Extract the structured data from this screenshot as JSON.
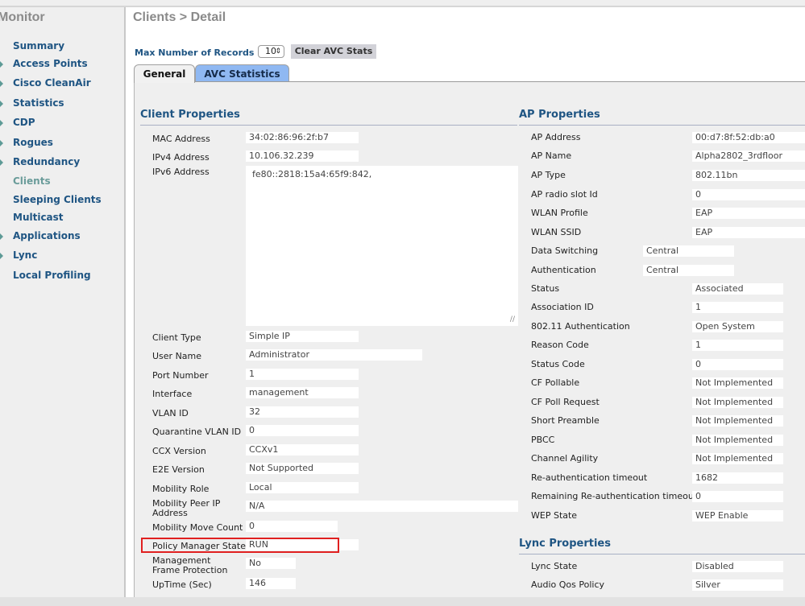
{
  "sidebar": {
    "title": "Monitor",
    "items": [
      {
        "label": "Summary",
        "expandable": false,
        "active": false
      },
      {
        "label": "Access Points",
        "expandable": true,
        "active": false
      },
      {
        "label": "Cisco CleanAir",
        "expandable": true,
        "active": false
      },
      {
        "label": "Statistics",
        "expandable": true,
        "active": false
      },
      {
        "label": "CDP",
        "expandable": true,
        "active": false
      },
      {
        "label": "Rogues",
        "expandable": true,
        "active": false
      },
      {
        "label": "Redundancy",
        "expandable": true,
        "active": false
      },
      {
        "label": "Clients",
        "expandable": false,
        "active": true
      },
      {
        "label": "Sleeping Clients",
        "expandable": false,
        "active": false
      },
      {
        "label": "Multicast",
        "expandable": false,
        "active": false
      },
      {
        "label": "Applications",
        "expandable": true,
        "active": false
      },
      {
        "label": "Lync",
        "expandable": true,
        "active": false
      },
      {
        "label": "Local Profiling",
        "expandable": false,
        "active": false
      }
    ]
  },
  "header": {
    "title": "Clients > Detail",
    "max_records_label": "Max Number of Records",
    "max_records_value": "10",
    "clear_avc_label": "Clear AVC Stats"
  },
  "tabs": [
    {
      "label": "General",
      "active": true
    },
    {
      "label": "AVC Statistics",
      "active": false
    }
  ],
  "client_properties": {
    "title": "Client Properties",
    "fields": [
      {
        "label": "MAC Address",
        "value": "34:02:86:96:2f:b7"
      },
      {
        "label": "IPv4 Address",
        "value": "10.106.32.239"
      },
      {
        "label": "IPv6 Address",
        "value": "fe80::2818:15a4:65f9:842,"
      },
      {
        "label": "Client Type",
        "value": "Simple IP"
      },
      {
        "label": "User Name",
        "value": "Administrator"
      },
      {
        "label": "Port Number",
        "value": "1"
      },
      {
        "label": "Interface",
        "value": "management"
      },
      {
        "label": "VLAN ID",
        "value": "32"
      },
      {
        "label": "Quarantine VLAN ID",
        "value": "0"
      },
      {
        "label": "CCX Version",
        "value": "CCXv1"
      },
      {
        "label": "E2E Version",
        "value": "Not Supported"
      },
      {
        "label": "Mobility Role",
        "value": "Local"
      },
      {
        "label": "Mobility Peer IP Address",
        "value": "N/A"
      },
      {
        "label": "Mobility Move Count",
        "value": "0"
      },
      {
        "label": "Policy Manager State",
        "value": "RUN",
        "highlighted": true
      },
      {
        "label": "Management Frame Protection",
        "value": "No"
      },
      {
        "label": "UpTime (Sec)",
        "value": "146"
      }
    ]
  },
  "ap_properties": {
    "title": "AP Properties",
    "fields": [
      {
        "label": "AP Address",
        "value": "00:d7:8f:52:db:a0"
      },
      {
        "label": "AP Name",
        "value": "Alpha2802_3rdfloor"
      },
      {
        "label": "AP Type",
        "value": "802.11bn"
      },
      {
        "label": "AP radio slot Id",
        "value": "0"
      },
      {
        "label": "WLAN Profile",
        "value": "EAP"
      },
      {
        "label": "WLAN SSID",
        "value": "EAP"
      },
      {
        "label": "Data Switching",
        "value": "Central"
      },
      {
        "label": "Authentication",
        "value": "Central"
      },
      {
        "label": "Status",
        "value": "Associated"
      },
      {
        "label": "Association ID",
        "value": "1"
      },
      {
        "label": "802.11 Authentication",
        "value": "Open System"
      },
      {
        "label": "Reason Code",
        "value": "1"
      },
      {
        "label": "Status Code",
        "value": "0"
      },
      {
        "label": "CF Pollable",
        "value": "Not Implemented"
      },
      {
        "label": "CF Poll Request",
        "value": "Not Implemented"
      },
      {
        "label": "Short Preamble",
        "value": "Not Implemented"
      },
      {
        "label": "PBCC",
        "value": "Not Implemented"
      },
      {
        "label": "Channel Agility",
        "value": "Not Implemented"
      },
      {
        "label": "Re-authentication timeout",
        "value": "1682"
      },
      {
        "label": "Remaining Re-authentication timeout",
        "value": "0"
      },
      {
        "label": "WEP State",
        "value": "WEP Enable"
      }
    ]
  },
  "lync_properties": {
    "title": "Lync Properties",
    "fields": [
      {
        "label": "Lync State",
        "value": "Disabled"
      },
      {
        "label": "Audio Qos Policy",
        "value": "Silver"
      }
    ]
  },
  "colors": {
    "nav_link": "#1f5583",
    "nav_active": "#6a9c9a",
    "tab_active_alt": "#8fb8f2",
    "highlight_box": "#e02020"
  }
}
